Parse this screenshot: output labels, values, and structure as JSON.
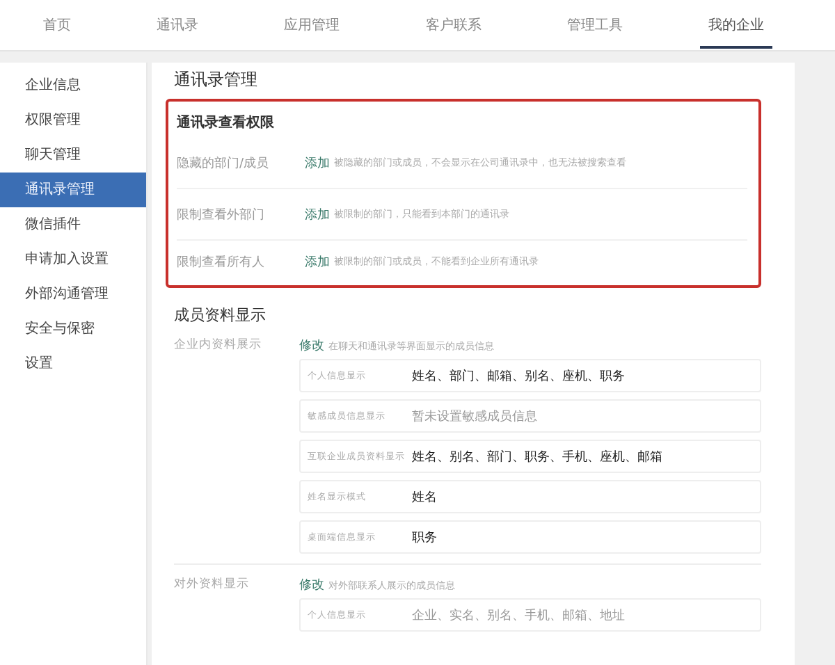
{
  "nav": [
    {
      "label": "首页",
      "selected": false
    },
    {
      "label": "通讯录",
      "selected": false
    },
    {
      "label": "应用管理",
      "selected": false
    },
    {
      "label": "客户联系",
      "selected": false
    },
    {
      "label": "管理工具",
      "selected": false
    },
    {
      "label": "我的企业",
      "selected": true
    }
  ],
  "sidebar": {
    "items": [
      {
        "label": "企业信息",
        "selected": false
      },
      {
        "label": "权限管理",
        "selected": false
      },
      {
        "label": "聊天管理",
        "selected": false
      },
      {
        "label": "通讯录管理",
        "selected": true
      },
      {
        "label": "微信插件",
        "selected": false
      },
      {
        "label": "申请加入设置",
        "selected": false
      },
      {
        "label": "外部沟通管理",
        "selected": false
      },
      {
        "label": "安全与保密",
        "selected": false
      },
      {
        "label": "设置",
        "selected": false
      }
    ]
  },
  "page_title": "通讯录管理",
  "permissions": {
    "title": "通讯录查看权限",
    "highlighted": true,
    "rows": [
      {
        "label": "隐藏的部门/成员",
        "action": "添加",
        "hint": "被隐藏的部门或成员，不会显示在公司通讯录中，也无法被搜索查看"
      },
      {
        "label": "限制查看外部门",
        "action": "添加",
        "hint": "被限制的部门，只能看到本部门的通讯录"
      },
      {
        "label": "限制查看所有人",
        "action": "添加",
        "hint": "被限制的部门或成员，不能看到企业所有通讯录"
      }
    ]
  },
  "member_display": {
    "title": "成员资料显示",
    "groups": [
      {
        "label": "企业内资料展示",
        "action": "修改",
        "hint": "在聊天和通讯录等界面显示的成员信息",
        "fields": [
          {
            "label": "个人信息显示",
            "value": "姓名、部门、邮箱、别名、座机、职务",
            "muted": false
          },
          {
            "label": "敏感成员信息显示",
            "value": "暂未设置敏感成员信息",
            "muted": true
          },
          {
            "label": "互联企业成员资料显示",
            "value": "姓名、别名、部门、职务、手机、座机、邮箱",
            "muted": false
          },
          {
            "label": "姓名显示模式",
            "value": "姓名",
            "muted": false
          },
          {
            "label": "桌面端信息显示",
            "value": "职务",
            "muted": false
          }
        ]
      },
      {
        "label": "对外资料显示",
        "action": "修改",
        "hint": "对外部联系人展示的成员信息",
        "fields": [
          {
            "label": "个人信息显示",
            "value": "企业、实名、别名、手机、邮箱、地址",
            "muted": true
          }
        ]
      }
    ]
  }
}
